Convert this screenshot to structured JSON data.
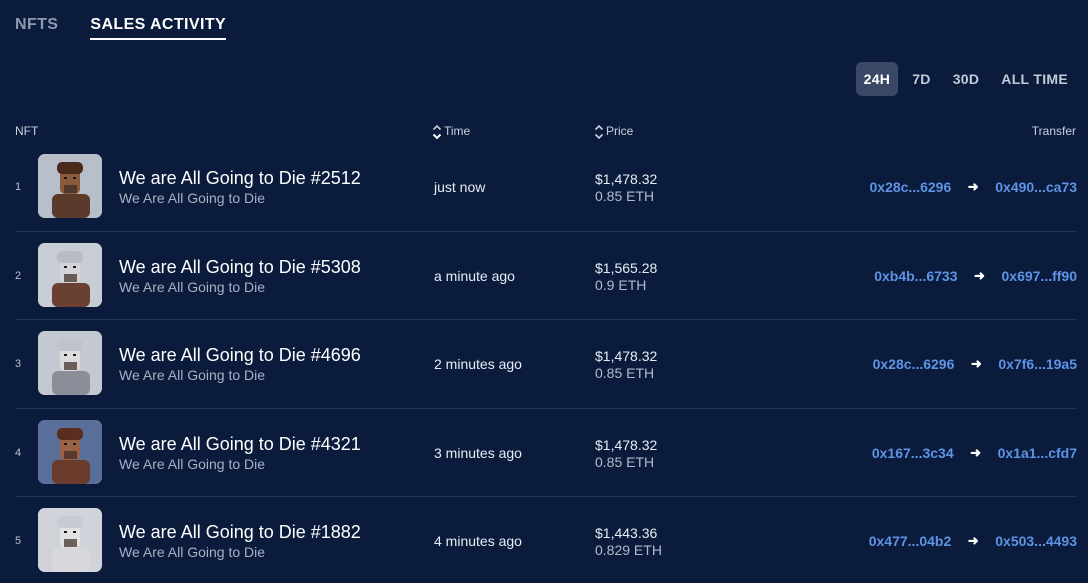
{
  "tabs": [
    {
      "label": "NFTS",
      "active": false
    },
    {
      "label": "SALES ACTIVITY",
      "active": true
    }
  ],
  "periods": [
    {
      "label": "24H",
      "active": true
    },
    {
      "label": "7D",
      "active": false
    },
    {
      "label": "30D",
      "active": false
    },
    {
      "label": "ALL TIME",
      "active": false
    }
  ],
  "table": {
    "headers": {
      "nft": "NFT",
      "time": "Time",
      "price": "Price",
      "transfer": "Transfer"
    },
    "rows": [
      {
        "rank": "1",
        "name": "We are All Going to Die #2512",
        "collection": "We Are All Going to Die",
        "time": "just now",
        "price_usd": "$1,478.32",
        "price_eth": "0.85 ETH",
        "from": "0x28c...6296",
        "to": "0x490...ca73",
        "thumb_bg": "#b9bfca",
        "skin": "#8a5a3c",
        "hair": "#4a2a1a",
        "outfit": "#5a3a2a"
      },
      {
        "rank": "2",
        "name": "We are All Going to Die #5308",
        "collection": "We Are All Going to Die",
        "time": "a minute ago",
        "price_usd": "$1,565.28",
        "price_eth": "0.9 ETH",
        "from": "0xb4b...6733",
        "to": "0x697...ff90",
        "thumb_bg": "#c8ccd4",
        "skin": "#d4d4d8",
        "hair": "#b8bcc4",
        "outfit": "#6a4030"
      },
      {
        "rank": "3",
        "name": "We are All Going to Die #4696",
        "collection": "We Are All Going to Die",
        "time": "2 minutes ago",
        "price_usd": "$1,478.32",
        "price_eth": "0.85 ETH",
        "from": "0x28c...6296",
        "to": "0x7f6...19a5",
        "thumb_bg": "#c4c8d0",
        "skin": "#dcdcde",
        "hair": "#c0c4ca",
        "outfit": "#8a8e98"
      },
      {
        "rank": "4",
        "name": "We are All Going to Die #4321",
        "collection": "We Are All Going to Die",
        "time": "3 minutes ago",
        "price_usd": "$1,478.32",
        "price_eth": "0.85 ETH",
        "from": "0x167...3c34",
        "to": "0x1a1...cfd7",
        "thumb_bg": "#5a6e9a",
        "skin": "#9a6244",
        "hair": "#5a2e1e",
        "outfit": "#6a3a2a"
      },
      {
        "rank": "5",
        "name": "We are All Going to Die #1882",
        "collection": "We Are All Going to Die",
        "time": "4 minutes ago",
        "price_usd": "$1,443.36",
        "price_eth": "0.829 ETH",
        "from": "0x477...04b2",
        "to": "0x503...4493",
        "thumb_bg": "#d0d4da",
        "skin": "#e2e2e4",
        "hair": "#c8ccd2",
        "outfit": "#d8d8dc"
      }
    ]
  },
  "colors": {
    "background": "#0a1b3c",
    "link": "#5e93e6",
    "active_filter": "#3a4866"
  }
}
